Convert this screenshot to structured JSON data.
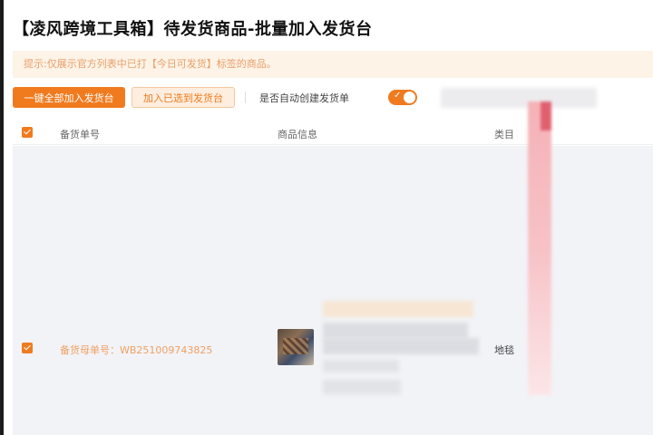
{
  "page": {
    "title": "【凌风跨境工具箱】待发货商品-批量加入发货台",
    "notice": "提示:仅展示官方列表中已打【今日可发货】标签的商品。"
  },
  "toolbar": {
    "add_all_label": "一键全部加入发货台",
    "add_selected_label": "加入已选到发货台",
    "auto_create_label": "是否自动创建发货单",
    "auto_create_enabled": true,
    "toggle_check_glyph": "✓"
  },
  "table": {
    "columns": [
      "备货单号",
      "商品信息",
      "类目"
    ],
    "rows": [
      {
        "checked": true,
        "stock_order_no": "备货母单号：WB251009743825",
        "category": "地毯"
      }
    ]
  },
  "colors": {
    "accent": "#f07b1f",
    "notice_bg": "#fdf3e7",
    "notice_text": "#e8a06a",
    "body_bg": "#f2f3f7"
  }
}
